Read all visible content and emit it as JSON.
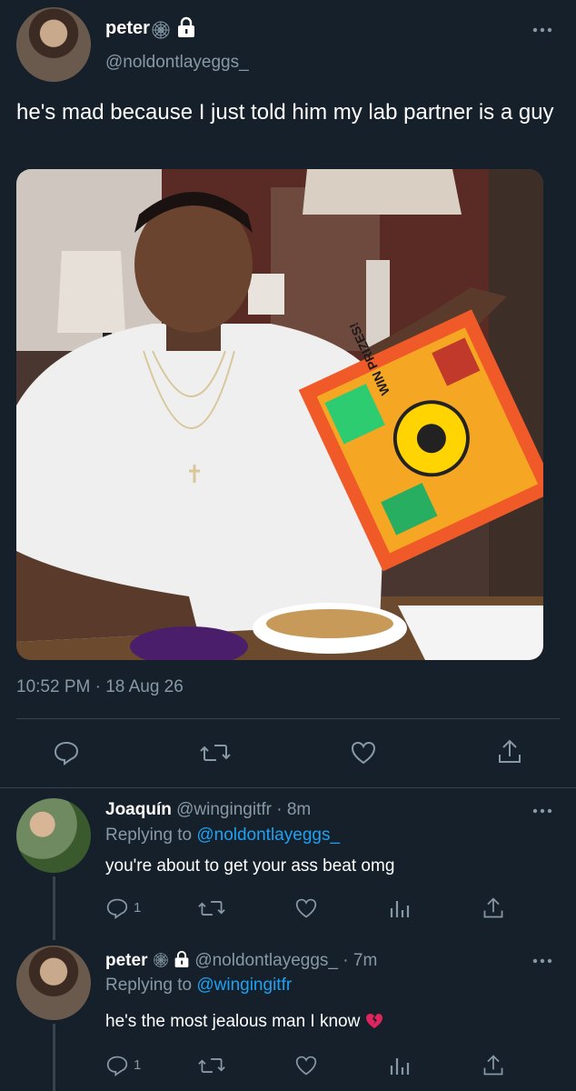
{
  "main_tweet": {
    "display_name": "peter",
    "handle": "@noldontlayeggs_",
    "text": "he's mad because I just told him my lab partner is a guy",
    "timestamp": "10:52 PM · 18 Aug 26",
    "image_alt": "man holding cereal box next to a bowl of cereal",
    "cereal_box_text": "WIN PRIZES!"
  },
  "replies": [
    {
      "display_name": "Joaquín",
      "handle": "@wingingitfr",
      "time": "· 8m",
      "replying_to_label": "Replying to",
      "replying_to": "@noldontlayeggs_",
      "text": "you're about to get your ass beat omg",
      "reply_count": "1"
    },
    {
      "display_name": "peter",
      "handle": "@noldontlayeggs_",
      "time": "· 7m",
      "replying_to_label": "Replying to",
      "replying_to": "@wingingitfr",
      "text": "he's the most jealous man I know",
      "reply_count": "1"
    }
  ],
  "icons": {
    "more": "more-dots-icon",
    "lock": "lock-icon",
    "badge": "spider-web-icon",
    "reply": "reply-icon",
    "retweet": "retweet-icon",
    "like": "heart-icon",
    "share": "share-icon",
    "analytics": "analytics-icon"
  },
  "colors": {
    "background": "#15202b",
    "muted": "#8899a6",
    "link": "#1da1f2",
    "divider": "#38444d"
  }
}
